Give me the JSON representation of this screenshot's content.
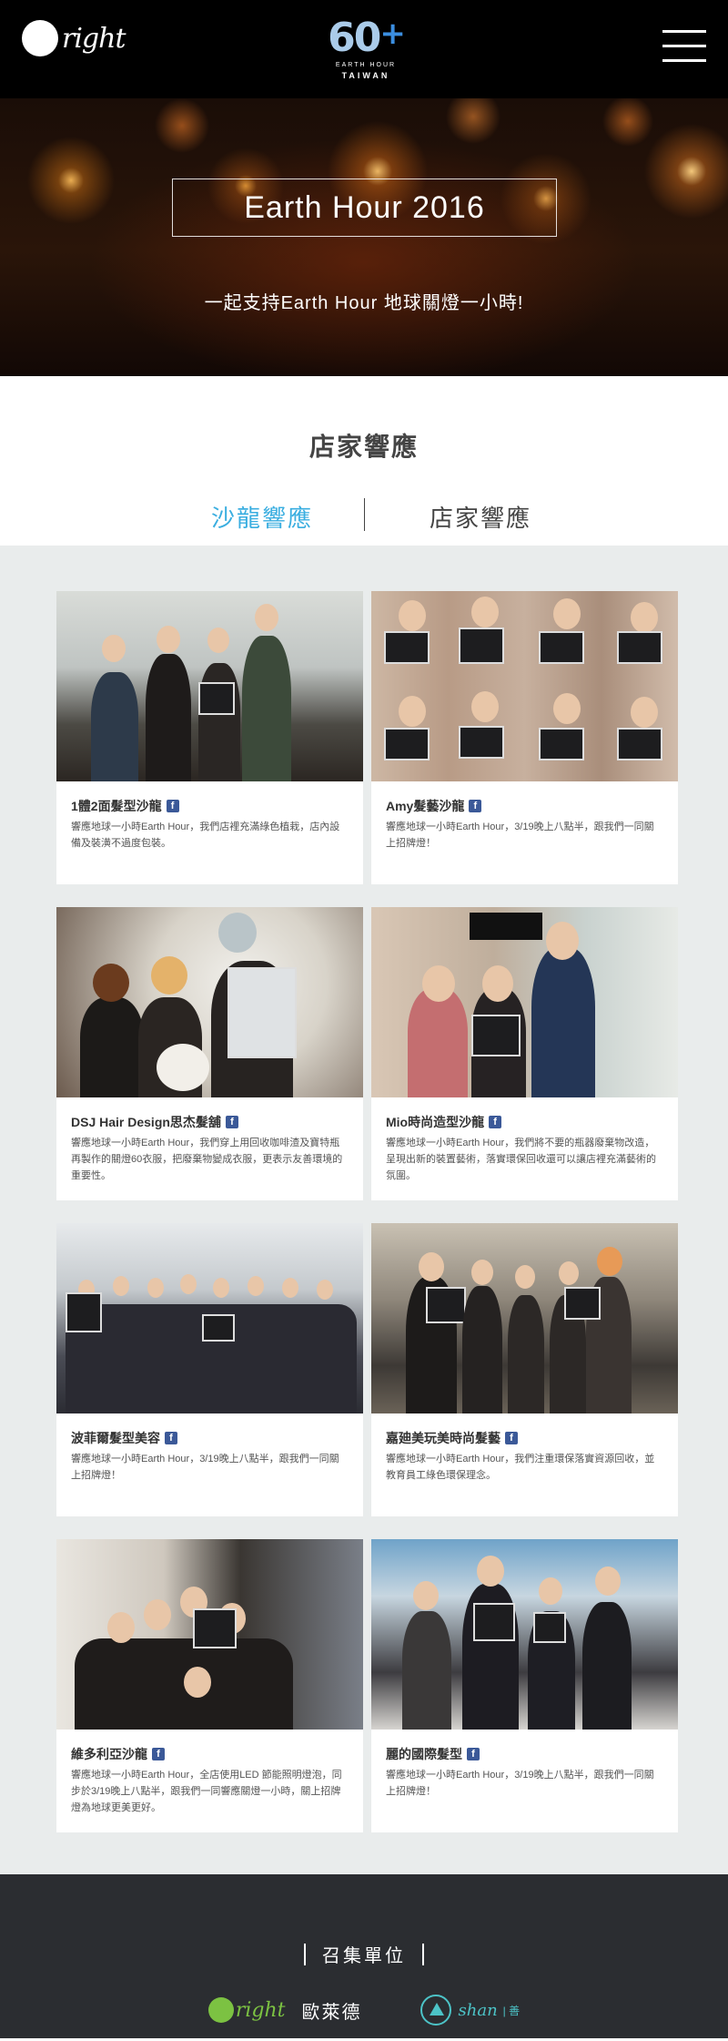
{
  "header": {
    "brand_text": "right",
    "earth_hour_number": "60",
    "earth_hour_plus": "+",
    "earth_hour_line1": "EARTH HOUR",
    "earth_hour_line2": "TAIWAN"
  },
  "hero": {
    "title": "Earth Hour 2016",
    "subtitle": "一起支持Earth Hour 地球關燈一小時!"
  },
  "section": {
    "title": "店家響應",
    "tabs": [
      "沙龍響應",
      "店家響應"
    ],
    "active_tab": "沙龍響應",
    "active_color": "#3aaee0"
  },
  "cards": [
    {
      "name": "1體2面髮型沙龍",
      "desc": "響應地球一小時Earth Hour，我們店裡充滿綠色植栽，店內設備及裝潢不過度包裝。"
    },
    {
      "name": "Amy髮藝沙龍",
      "desc": "響應地球一小時Earth Hour，3/19晚上八點半，跟我們一同關上招牌燈！"
    },
    {
      "name": "DSJ Hair Design思杰髮舖",
      "desc": "響應地球一小時Earth Hour，我們穿上用回收咖啡渣及寶特瓶再製作的關燈60衣服，把廢棄物變成衣服，更表示友善環境的重要性。"
    },
    {
      "name": "Mio時尚造型沙龍",
      "desc": "響應地球一小時Earth Hour，我們將不要的瓶器廢棄物改造，呈現出新的裝置藝術，落實環保回收還可以讓店裡充滿藝術的氛圍。"
    },
    {
      "name": "波菲爾髮型美容",
      "desc": "響應地球一小時Earth Hour，3/19晚上八點半，跟我們一同關上招牌燈！"
    },
    {
      "name": "嘉廸美玩美時尚髮藝",
      "desc": "響應地球一小時Earth Hour，我們注重環保落實資源回收，並教育員工綠色環保理念。"
    },
    {
      "name": "維多利亞沙龍",
      "desc": "響應地球一小時Earth Hour，全店使用LED 節能照明燈泡，同步於3/19晚上八點半，跟我們一同響應關燈一小時，關上招牌燈為地球更美更好。"
    },
    {
      "name": "麗的國際髮型",
      "desc": "響應地球一小時Earth Hour，3/19晚上八點半，跟我們一同關上招牌燈！"
    }
  ],
  "icons": {
    "facebook": "facebook-icon",
    "facebook_glyph": "f",
    "facebook_color": "#3b5998"
  },
  "footer": {
    "title": "召集單位",
    "partner1_logo_text": "right",
    "partner1_name": "歐萊德",
    "partner2_logo_text": "shan",
    "partner2_name": "| 善"
  }
}
